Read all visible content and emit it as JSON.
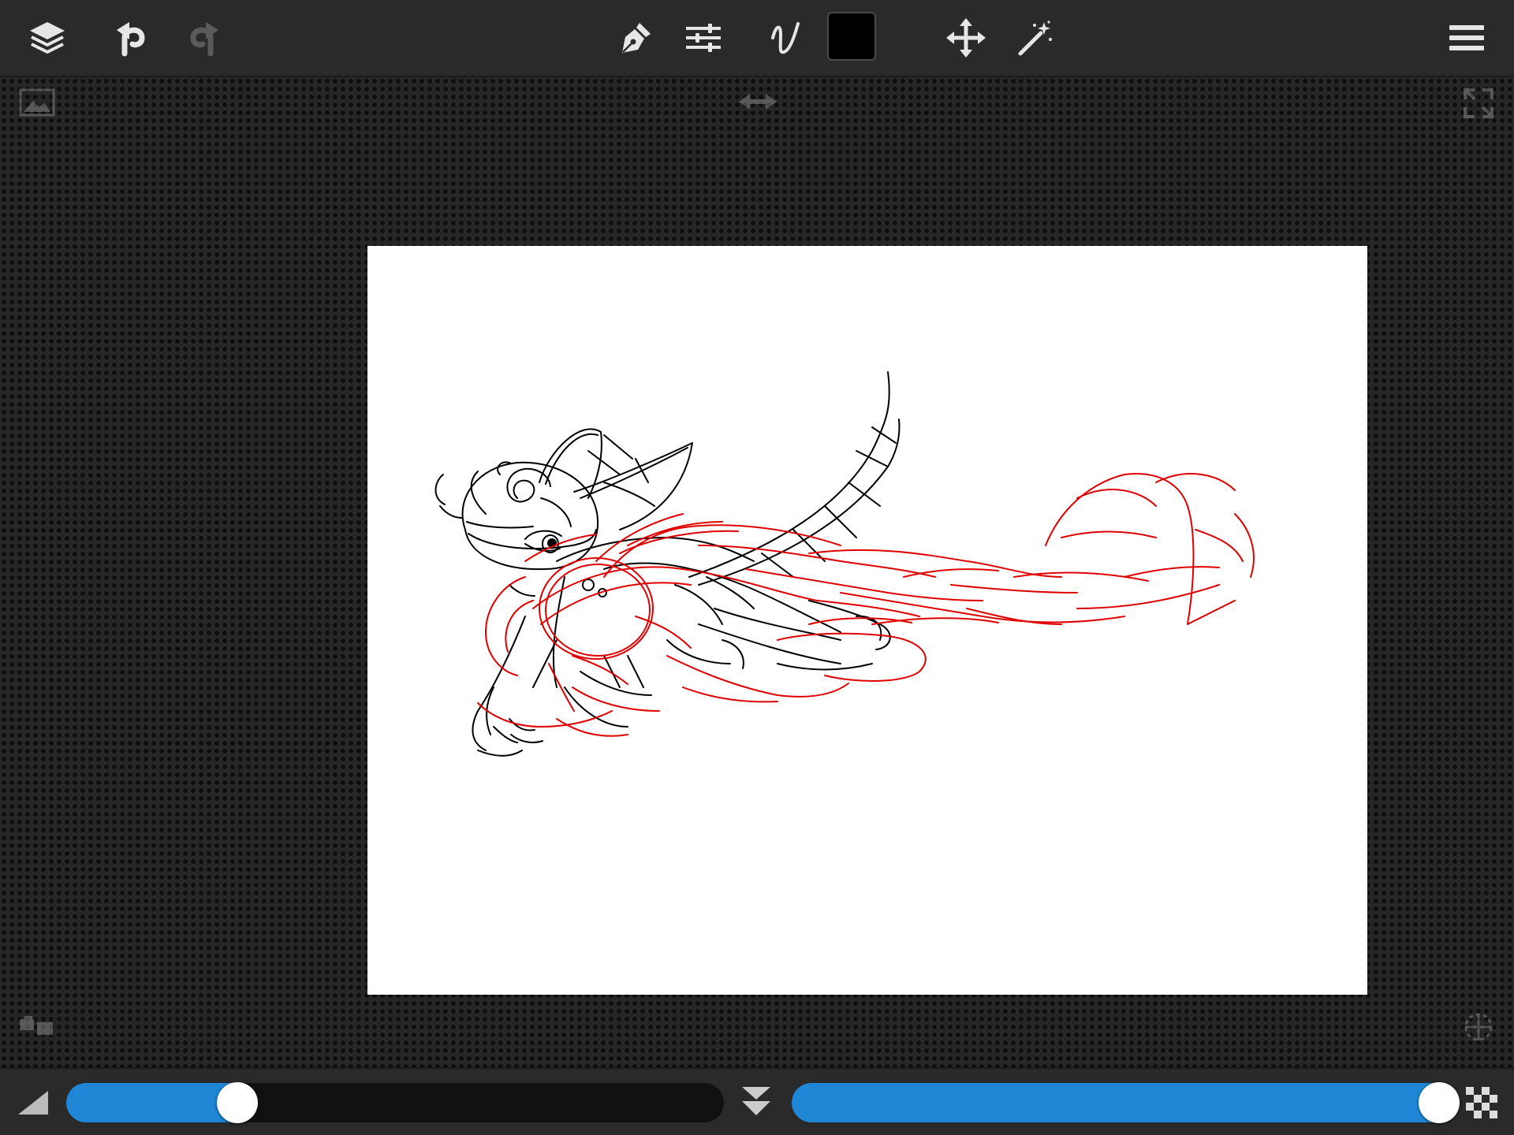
{
  "app": {
    "accent_color": "#1f87d6",
    "toolbar_color": "#2a2a2a"
  },
  "toolbar": {
    "left_icons": [
      "layers-icon",
      "undo-icon",
      "redo-icon"
    ],
    "center_icons": [
      "pen-nib-icon",
      "sliders-icon",
      "brush-stroke-icon",
      "color-swatch",
      "move-icon",
      "magic-wand-icon"
    ],
    "right_icons": [
      "menu-icon"
    ],
    "current_color": "#000000",
    "redo_enabled": false
  },
  "workspace": {
    "corner_icons": [
      "reference-image-icon",
      "flip-horizontal-icon",
      "fullscreen-icon",
      "layer-thumbnails-icon",
      "symmetry-icon"
    ]
  },
  "canvas": {
    "background": "#ffffff",
    "stroke_colors": [
      "#000000",
      "#e00000"
    ]
  },
  "bottombar": {
    "brush_size_percent": 26,
    "opacity_percent": 98,
    "icons": [
      "brush-size-icon",
      "collapse-icon",
      "opacity-checker-icon"
    ]
  }
}
